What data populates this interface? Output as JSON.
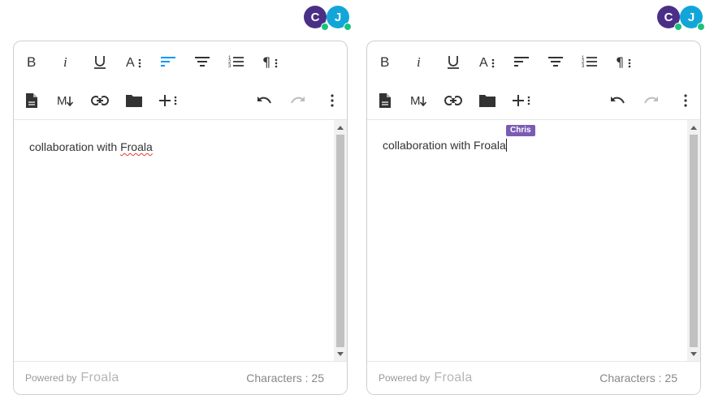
{
  "editors": [
    {
      "id": "left",
      "users": [
        {
          "initial": "C",
          "color": "#4a2f87"
        },
        {
          "initial": "J",
          "color": "#12a6d8"
        }
      ],
      "content_plain": "collaboration with ",
      "content_misspelled": "Froala",
      "cursor_label": "",
      "powered_by": "Powered by",
      "brand": "Froala",
      "characters": "Characters : 25"
    },
    {
      "id": "right",
      "users": [
        {
          "initial": "C",
          "color": "#4a2f87"
        },
        {
          "initial": "J",
          "color": "#12a6d8"
        }
      ],
      "content_plain": "collaboration with Froala",
      "content_misspelled": "",
      "cursor_label": "Chris",
      "powered_by": "Powered by",
      "brand": "Froala",
      "characters": "Characters : 25"
    }
  ],
  "toolbar": {
    "row1": [
      "bold-icon",
      "italic-icon",
      "underline-icon",
      "font-size-icon",
      "align-left-icon",
      "align-center-icon",
      "ordered-list-icon",
      "paragraph-format-icon"
    ],
    "row2": [
      "insert-file-icon",
      "markdown-icon",
      "link-icon",
      "folder-icon",
      "more-insert-icon",
      "undo-icon",
      "redo-icon",
      "more-options-icon"
    ],
    "active_color": "#0098f7",
    "disabled_color": "#bdbdbd"
  },
  "colors": {
    "presence_online": "#19c37d",
    "cursor_tag": "#7b5cb3",
    "spellcheck": "#e53935"
  }
}
